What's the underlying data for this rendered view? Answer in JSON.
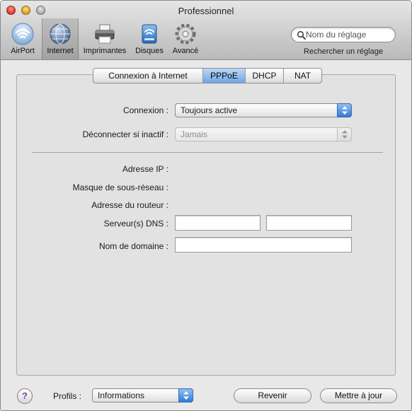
{
  "window": {
    "title": "Professionnel"
  },
  "toolbar": {
    "items": [
      {
        "label": "AirPort",
        "icon": "airport-icon"
      },
      {
        "label": "Internet",
        "icon": "internet-globe-icon",
        "selected": true
      },
      {
        "label": "Imprimantes",
        "icon": "printer-icon"
      },
      {
        "label": "Disques",
        "icon": "disks-icon"
      },
      {
        "label": "Avancé",
        "icon": "gear-icon"
      }
    ],
    "search": {
      "placeholder": "Nom du réglage",
      "caption": "Rechercher un réglage"
    }
  },
  "tabs": [
    {
      "label": "Connexion à Internet"
    },
    {
      "label": "PPPoE",
      "active": true
    },
    {
      "label": "DHCP"
    },
    {
      "label": "NAT"
    }
  ],
  "form": {
    "connexion_label": "Connexion :",
    "connexion_value": "Toujours active",
    "disconnect_label": "Déconnecter si inactif :",
    "disconnect_value": "Jamais",
    "ip_label": "Adresse IP :",
    "mask_label": "Masque de sous-réseau :",
    "router_label": "Adresse du routeur :",
    "dns_label": "Serveur(s) DNS :",
    "dns1_value": "",
    "dns2_value": "",
    "domain_label": "Nom de domaine :",
    "domain_value": ""
  },
  "footer": {
    "help_label": "?",
    "profiles_label": "Profils :",
    "profiles_value": "Informations",
    "revert_label": "Revenir",
    "update_label": "Mettre à jour"
  },
  "colors": {
    "accent_blue": "#3a82dc",
    "tab_active": "#8ebcf2"
  }
}
